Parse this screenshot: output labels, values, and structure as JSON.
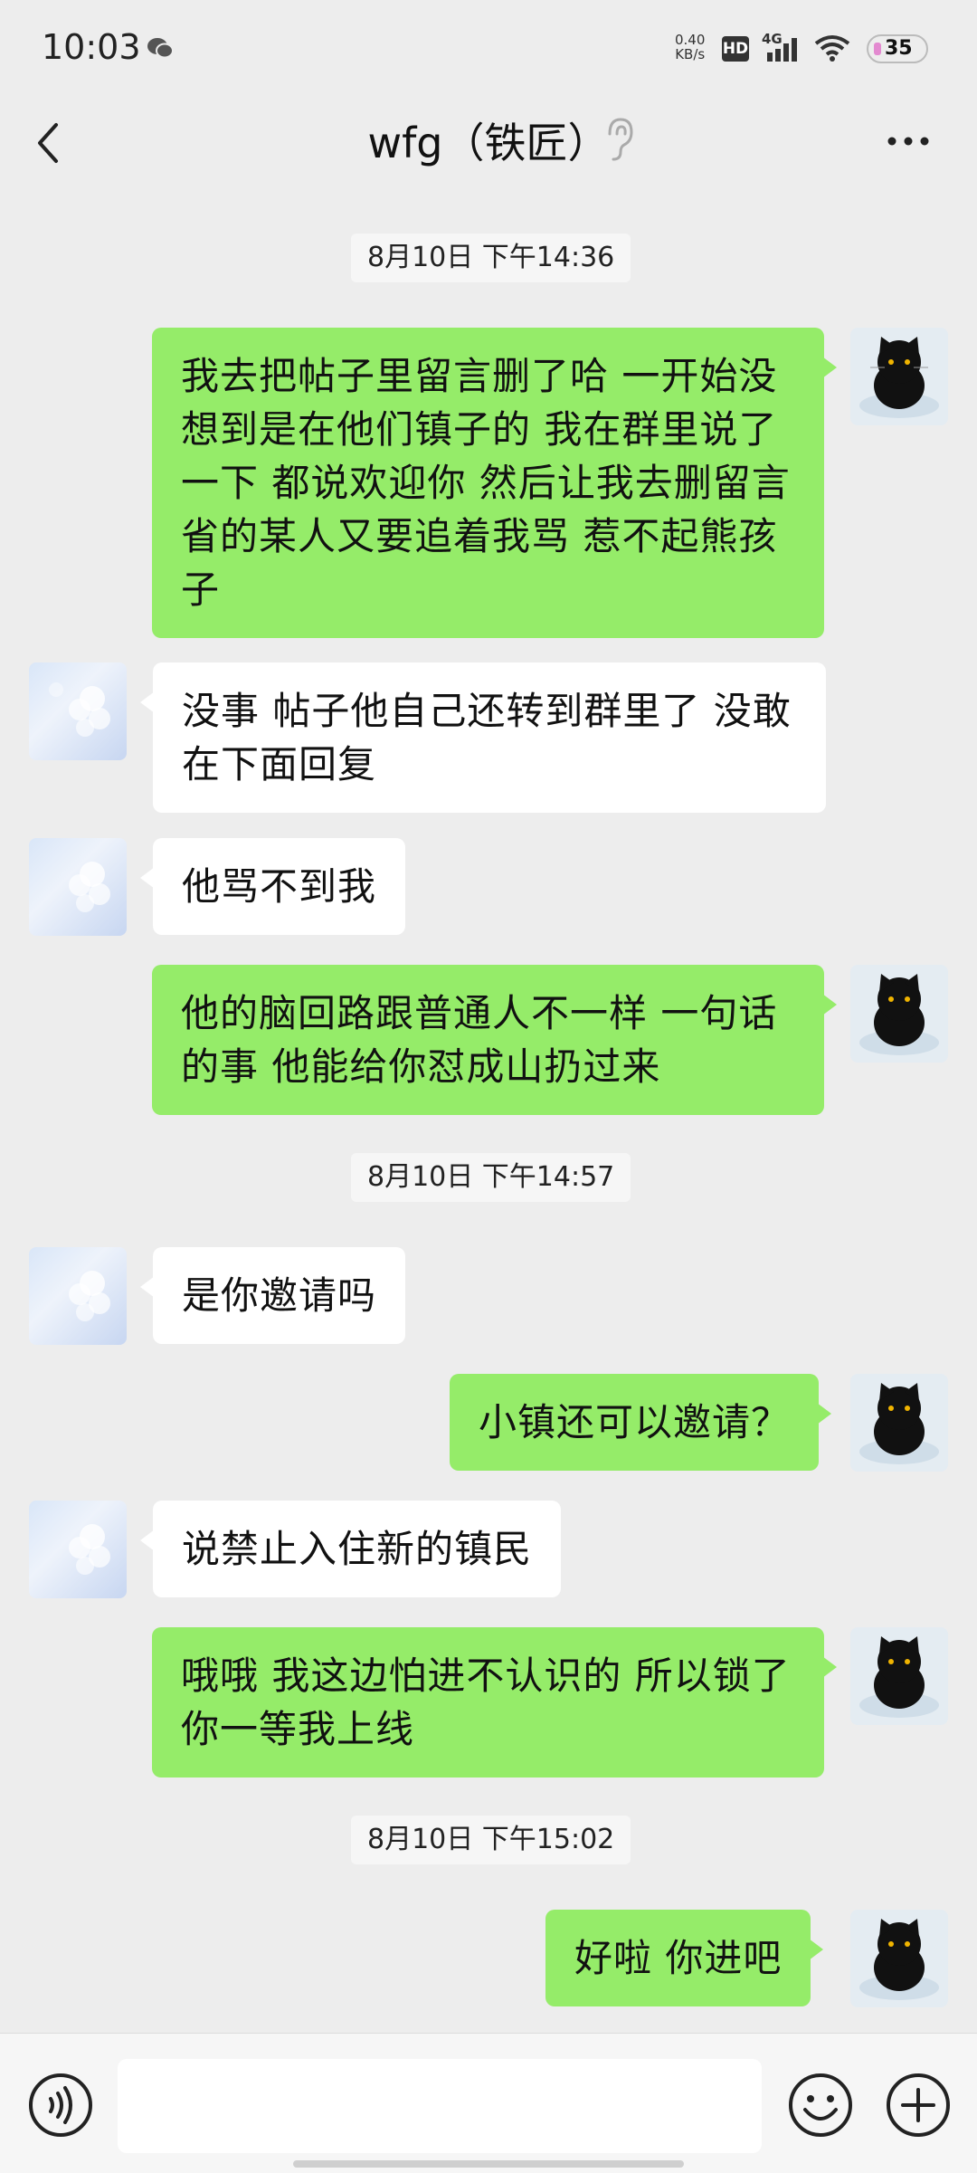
{
  "status_bar": {
    "time": "10:03",
    "net_speed_value": "0.40",
    "net_speed_unit": "KB/s",
    "hd": "HD",
    "network": "4G",
    "battery": "35"
  },
  "header": {
    "title": "wfg（铁匠）",
    "back_icon": "chevron-left-icon",
    "ear_icon": "ear-icon",
    "more_icon": "more-dots-icon"
  },
  "messages": [
    {
      "type": "timestamp",
      "text": "8月10日 下午14:36"
    },
    {
      "type": "me",
      "text": "我去把帖子里留言删了哈 一开始没想到是在他们镇子的 我在群里说了一下 都说欢迎你 然后让我去删留言 省的某人又要追着我骂 惹不起熊孩子"
    },
    {
      "type": "other",
      "text": "没事 帖子他自己还转到群里了 没敢在下面回复"
    },
    {
      "type": "other",
      "text": "他骂不到我"
    },
    {
      "type": "me",
      "text": "他的脑回路跟普通人不一样 一句话的事 他能给你怼成山扔过来"
    },
    {
      "type": "timestamp",
      "text": "8月10日 下午14:57"
    },
    {
      "type": "other",
      "text": "是你邀请吗"
    },
    {
      "type": "me",
      "text": "小镇还可以邀请？"
    },
    {
      "type": "other",
      "text": "说禁止入住新的镇民"
    },
    {
      "type": "me",
      "text": "哦哦 我这边怕进不认识的 所以锁了 你一等我上线"
    },
    {
      "type": "timestamp",
      "text": "8月10日 下午15:02"
    },
    {
      "type": "me",
      "text": "好啦 你进吧"
    }
  ],
  "input_bar": {
    "voice_icon": "voice-icon",
    "emoji_icon": "emoji-icon",
    "plus_icon": "plus-icon",
    "input_value": ""
  },
  "colors": {
    "background": "#ededed",
    "my_bubble": "#95ec69",
    "other_bubble": "#ffffff"
  }
}
